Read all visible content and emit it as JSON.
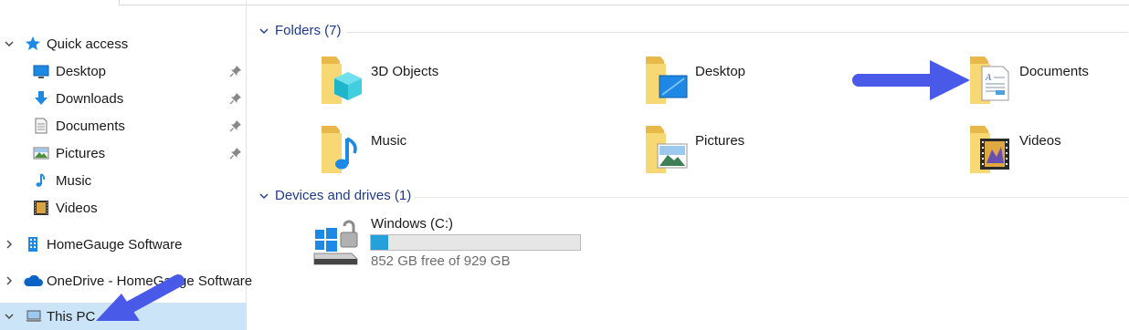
{
  "nav": {
    "items": [
      {
        "label": "Quick access",
        "icon": "star-icon",
        "expanded": true
      },
      {
        "label": "Desktop",
        "icon": "desktop-icon",
        "pinned": true
      },
      {
        "label": "Downloads",
        "icon": "download-arrow-icon",
        "pinned": true
      },
      {
        "label": "Documents",
        "icon": "document-icon",
        "pinned": true
      },
      {
        "label": "Pictures",
        "icon": "pictures-icon",
        "pinned": true
      },
      {
        "label": "Music",
        "icon": "music-note-icon"
      },
      {
        "label": "Videos",
        "icon": "film-strip-icon"
      },
      {
        "label": "HomeGauge Software",
        "icon": "building-icon",
        "expanded": false
      },
      {
        "label": "OneDrive - HomeGauge Software",
        "icon": "cloud-icon",
        "expanded": false
      },
      {
        "label": "This PC",
        "icon": "laptop-icon",
        "expanded": true,
        "selected": true
      }
    ]
  },
  "content": {
    "folders_header": "Folders (7)",
    "folders": [
      {
        "label": "3D Objects",
        "icon": "3d-objects-folder-icon"
      },
      {
        "label": "Desktop",
        "icon": "desktop-folder-icon"
      },
      {
        "label": "Documents",
        "icon": "documents-folder-icon"
      },
      {
        "label": "Music",
        "icon": "music-folder-icon"
      },
      {
        "label": "Pictures",
        "icon": "pictures-folder-icon"
      },
      {
        "label": "Videos",
        "icon": "videos-folder-icon"
      }
    ],
    "drives_header": "Devices and drives (1)",
    "drive": {
      "name": "Windows (C:)",
      "free_text": "852 GB free of 929 GB",
      "used_fraction": 0.083,
      "icon": "windows-drive-icon"
    }
  },
  "colors": {
    "accent": "#26a0da",
    "selection": "#cce4f7",
    "header_text": "#1e3a8a",
    "annotation_arrow": "#4a5ae8",
    "folder_yellow": "#f8d775"
  }
}
